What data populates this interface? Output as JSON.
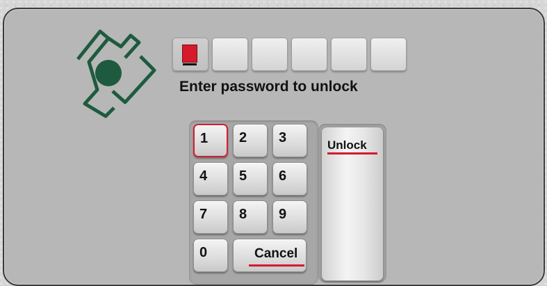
{
  "prompt": "Enter password to unlock",
  "pin": {
    "length": 6,
    "filled": 0,
    "active_index": 0
  },
  "keypad": {
    "keys": [
      "1",
      "2",
      "3",
      "4",
      "5",
      "6",
      "7",
      "8",
      "9",
      "0"
    ],
    "cancel_label": "Cancel",
    "unlock_label": "Unlock",
    "focused_key": "1"
  },
  "colors": {
    "logo_green": "#1e5b3e",
    "accent_red": "#d6192b",
    "panel_bg": "#b7b7b7"
  },
  "icons": {
    "logo": "pinwheel-logo-icon"
  }
}
